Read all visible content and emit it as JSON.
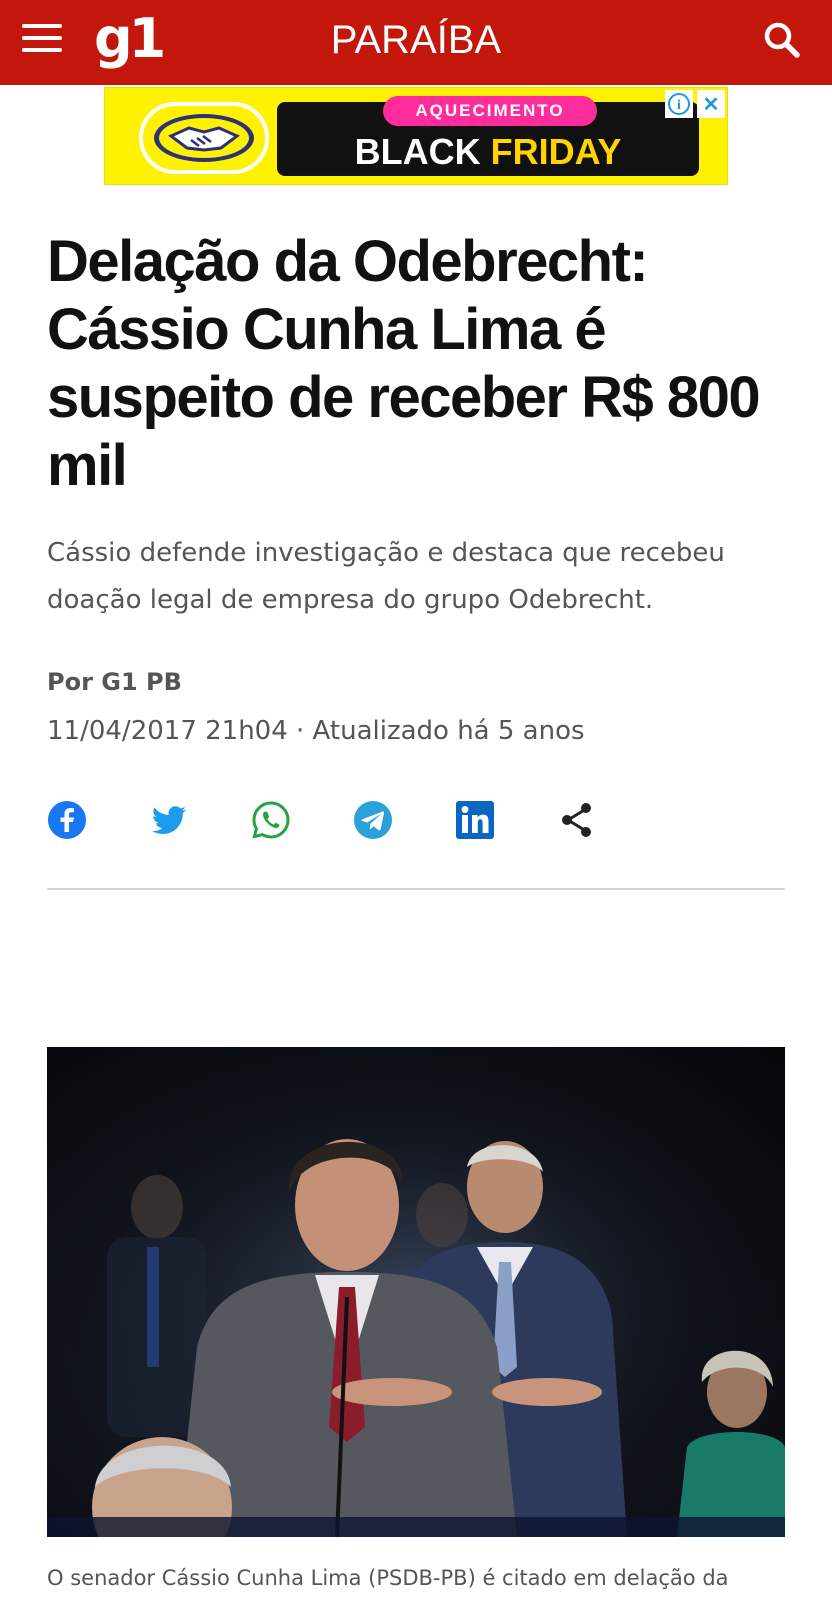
{
  "header": {
    "logo": "g1",
    "section": "PARAÍBA",
    "background_color": "#c4170c",
    "menu_icon": "hamburger-menu-icon",
    "search_icon": "search-icon"
  },
  "ad": {
    "pill_text": "AQUECIMENTO",
    "main_text_white": "BLACK",
    "main_text_highlight": "FRIDAY",
    "info_label": "i",
    "close_label": "✕",
    "background_color": "#fff200",
    "logo_icon": "handshake-icon"
  },
  "article": {
    "headline": "Delação da Odebrecht: Cássio Cunha Lima é suspeito de receber R$ 800 mil",
    "subtitle": "Cássio defende investigação e destaca que recebeu doação legal de empresa do grupo Odebrecht.",
    "author": "Por G1 PB",
    "dateline": "11/04/2017 21h04 · Atualizado há 5 anos",
    "caption": "O senador Cássio Cunha Lima (PSDB-PB) é citado em delação da"
  },
  "share": {
    "items": [
      {
        "name": "facebook",
        "icon": "facebook-icon",
        "color": "#1877f2"
      },
      {
        "name": "twitter",
        "icon": "twitter-icon",
        "color": "#1d9bf0"
      },
      {
        "name": "whatsapp",
        "icon": "whatsapp-icon",
        "color": "#25a244"
      },
      {
        "name": "telegram",
        "icon": "telegram-icon",
        "color": "#2aa1da"
      },
      {
        "name": "linkedin",
        "icon": "linkedin-icon",
        "color": "#0a66c2"
      },
      {
        "name": "share",
        "icon": "share-icon",
        "color": "#222222"
      }
    ]
  }
}
